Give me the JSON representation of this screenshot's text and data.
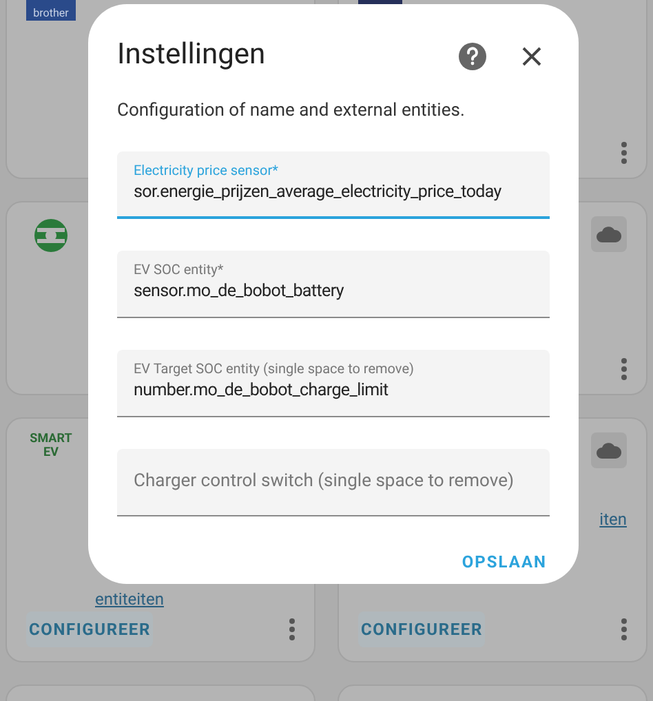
{
  "cards": [
    {
      "kind": "brother",
      "logo_lines": [
        "brother"
      ]
    },
    {
      "kind": "tile",
      "menu": true
    },
    {
      "kind": "ring"
    },
    {
      "kind": "plain",
      "cloud": true,
      "menu": true
    },
    {
      "kind": "smart_ev",
      "logo_lines": [
        "SMART",
        "EV"
      ],
      "link": "entiteiten",
      "button": "CONFIGUREER",
      "menu": true
    },
    {
      "kind": "plain",
      "link": "iten",
      "button": "CONFIGUREER",
      "cloud": true,
      "menu": true
    },
    {
      "kind": "plain"
    },
    {
      "kind": "plain"
    }
  ],
  "dialog": {
    "title": "Instellingen",
    "description": "Configuration of name and external entities.",
    "fields": [
      {
        "label": "Electricity price sensor*",
        "value": "sor.energie_prijzen_average_electricity_price_today",
        "focused": true
      },
      {
        "label": "EV SOC entity*",
        "value": "sensor.mo_de_bobot_battery",
        "focused": false
      },
      {
        "label": "EV Target SOC entity (single space to remove)",
        "value": "number.mo_de_bobot_charge_limit",
        "focused": false
      },
      {
        "placeholder": "Charger control switch (single space to remove)",
        "focused": false
      }
    ],
    "save_button": "OPSLAAN"
  }
}
